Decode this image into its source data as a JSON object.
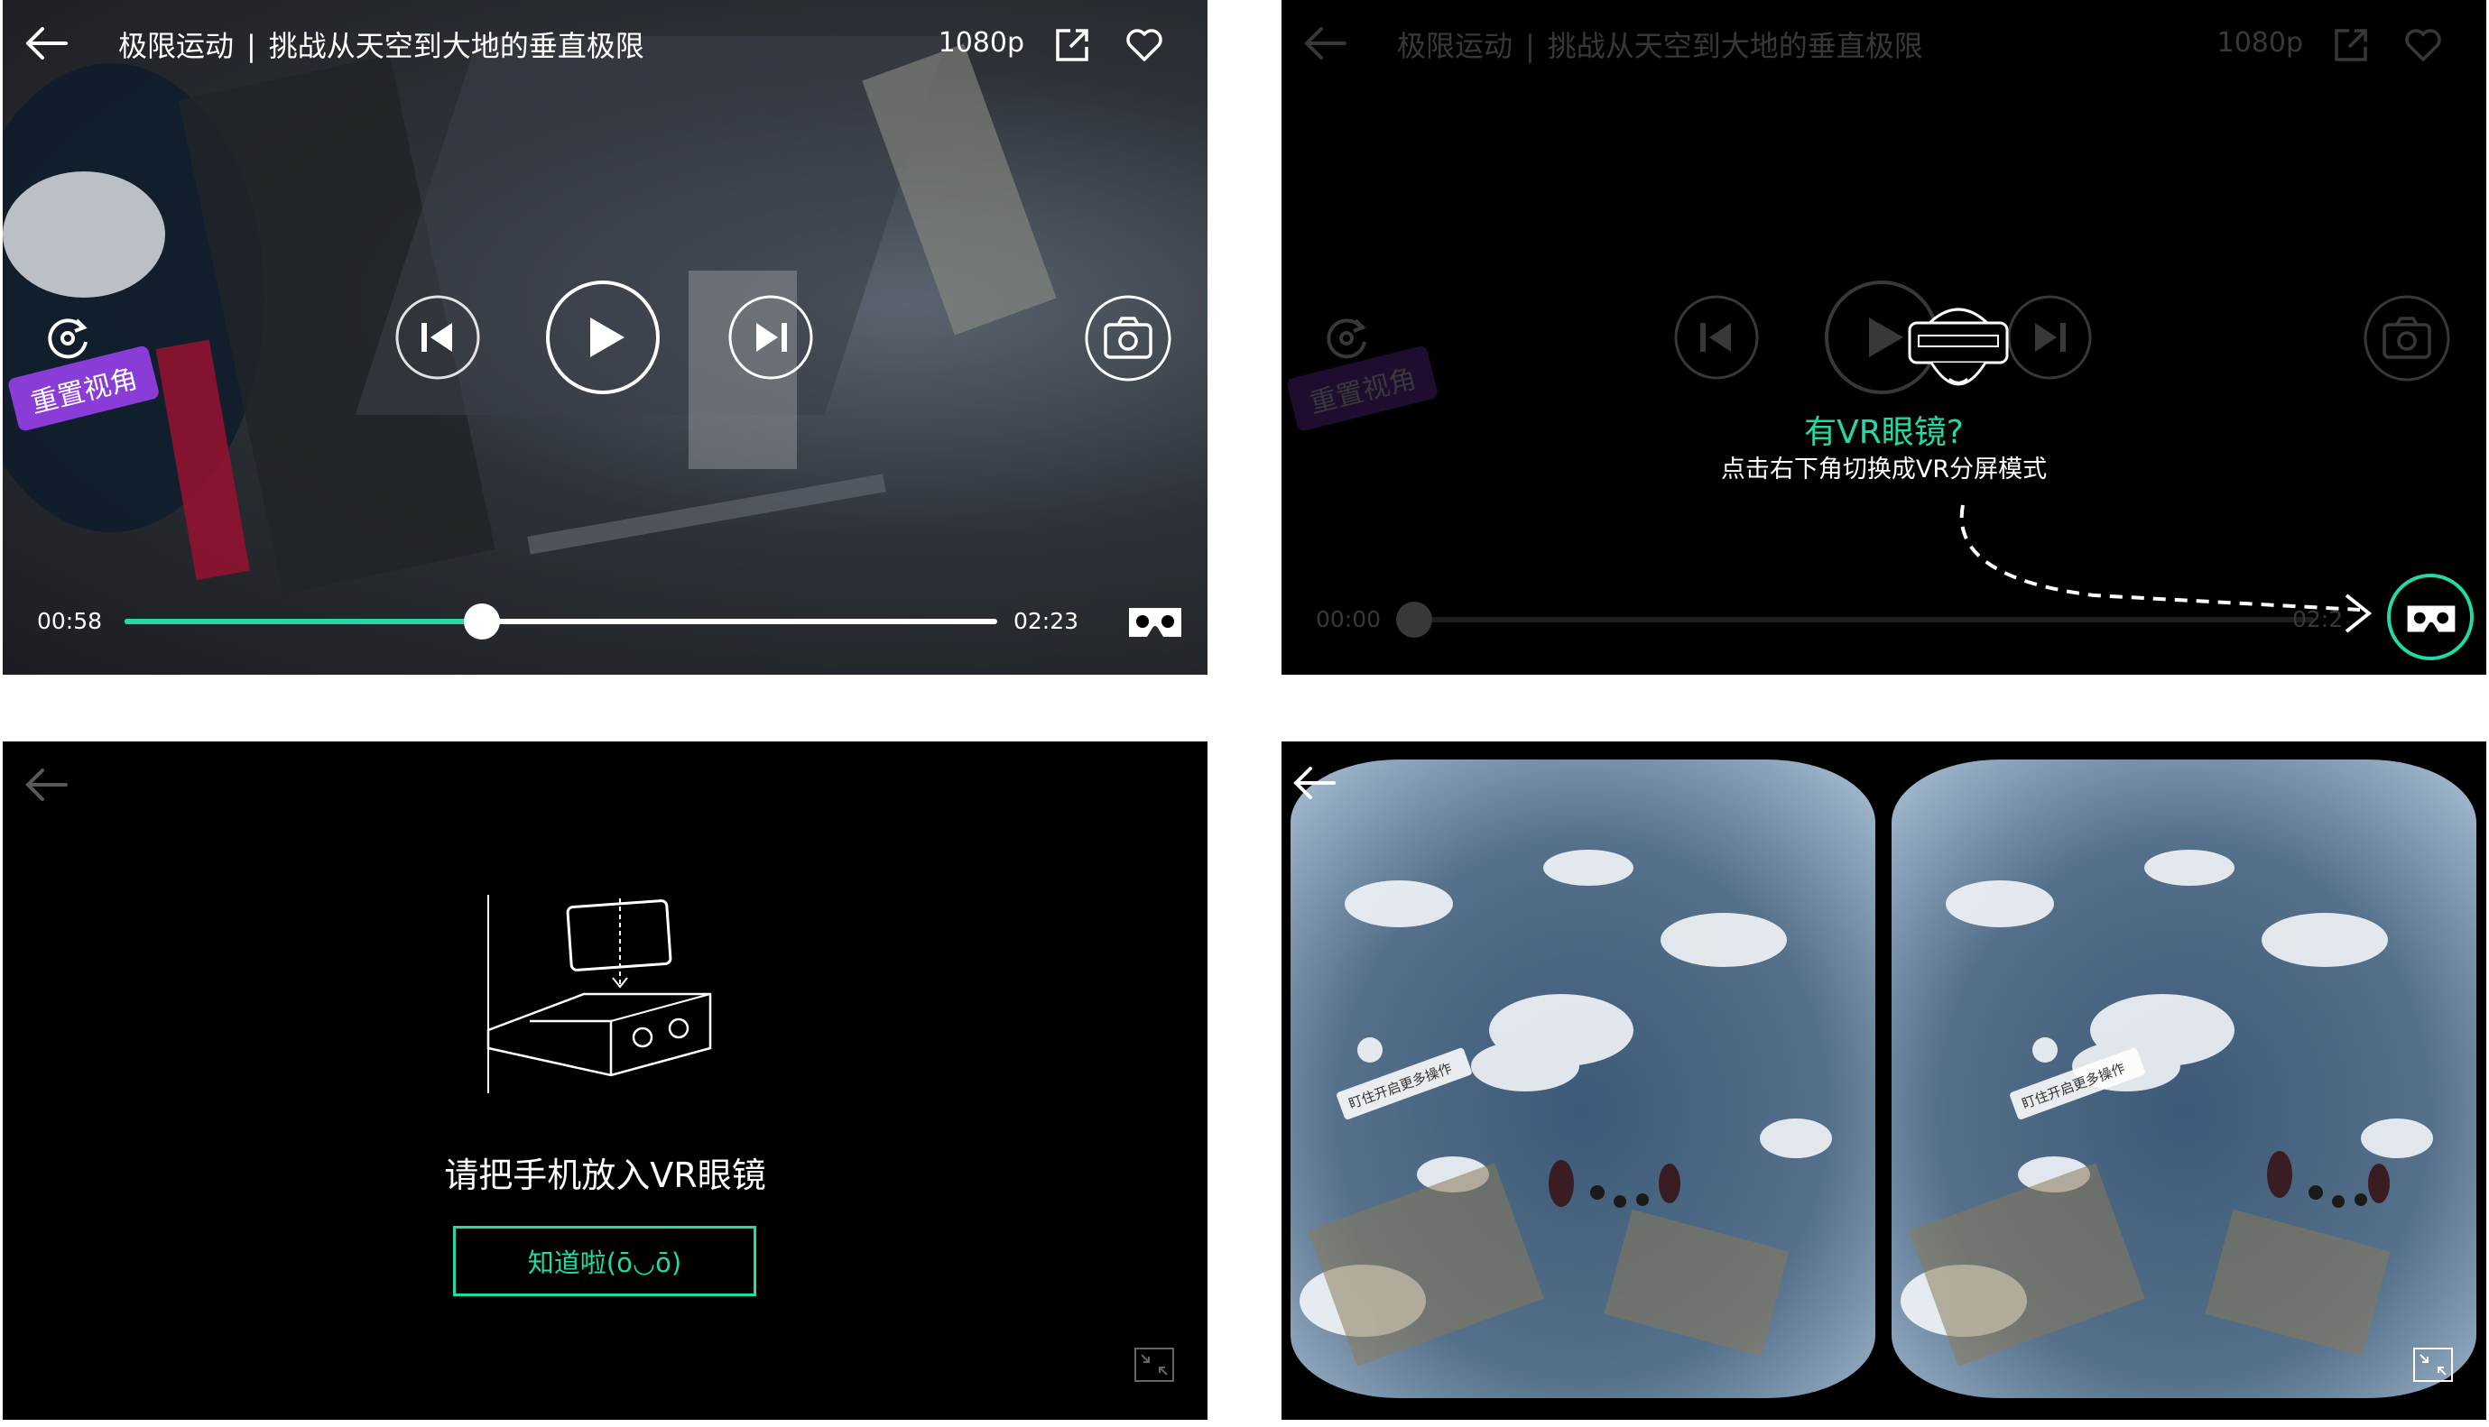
{
  "video": {
    "title_prefix": "极限运动",
    "title_separator": "|",
    "title_main": "挑战从天空到大地的垂直极限",
    "quality": "1080p",
    "reset_view_label": "重置视角",
    "current_time": "00:58",
    "duration": "02:23",
    "progress_fraction": 0.41
  },
  "vr_tip": {
    "current_time": "00:00",
    "duration_partial": "02:2",
    "title": "有VR眼镜?",
    "subtitle": "点击右下角切换成VR分屏模式"
  },
  "phone_setup": {
    "instruction": "请把手机放入VR眼镜",
    "ok_button": "知道啦(ō◡ō)"
  },
  "vr_view": {
    "hotspot_label": "盯住开启更多操作"
  },
  "colors": {
    "accent": "#23d9a5",
    "badge": "#8a3cd7"
  },
  "icons": [
    "back-icon",
    "share-icon",
    "heart-icon",
    "reset-view-icon",
    "previous-icon",
    "play-icon",
    "next-icon",
    "camera-icon",
    "vr-glasses-icon",
    "shrink-icon"
  ]
}
